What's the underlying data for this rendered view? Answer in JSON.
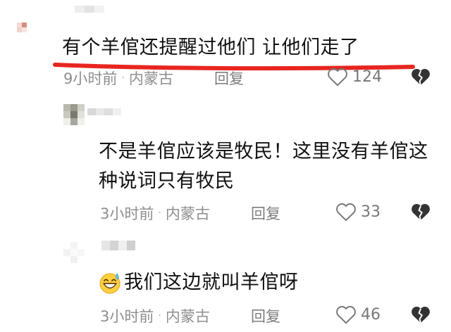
{
  "comments": [
    {
      "text": "有个羊倌还提醒过他们 让他们走了",
      "time": "9小时前",
      "location": "内蒙古",
      "reply_label": "回复",
      "likes": "124",
      "highlighted": true,
      "avatar_colors": [
        "#f3dcd5",
        "#d98c7c",
        "#efd3cc",
        "#f7e6e2"
      ]
    },
    {
      "text_lines": [
        "不是羊倌应该是牧民！这里没有羊倌这",
        "种说词只有牧民"
      ],
      "time": "3小时前",
      "location": "内蒙古",
      "reply_label": "回复",
      "likes": "33",
      "avatar_colors": [
        "#9a9a8e",
        "#c9c9c0",
        "#7a7a70",
        "#e1e1da"
      ]
    },
    {
      "emoji": "grinning-sweat-emoji",
      "text": "我们这边就叫羊倌呀",
      "time": "3小时前",
      "location": "内蒙古",
      "reply_label": "回复",
      "likes": "46",
      "avatar_colors": [
        "#e6e6e6",
        "#d4d4d4",
        "#f0f0f0",
        "#cfcfcf"
      ]
    }
  ],
  "colors": {
    "text": "#111111",
    "meta": "#8e8e8e",
    "highlight_line": "#e8251f"
  },
  "separator": "·"
}
